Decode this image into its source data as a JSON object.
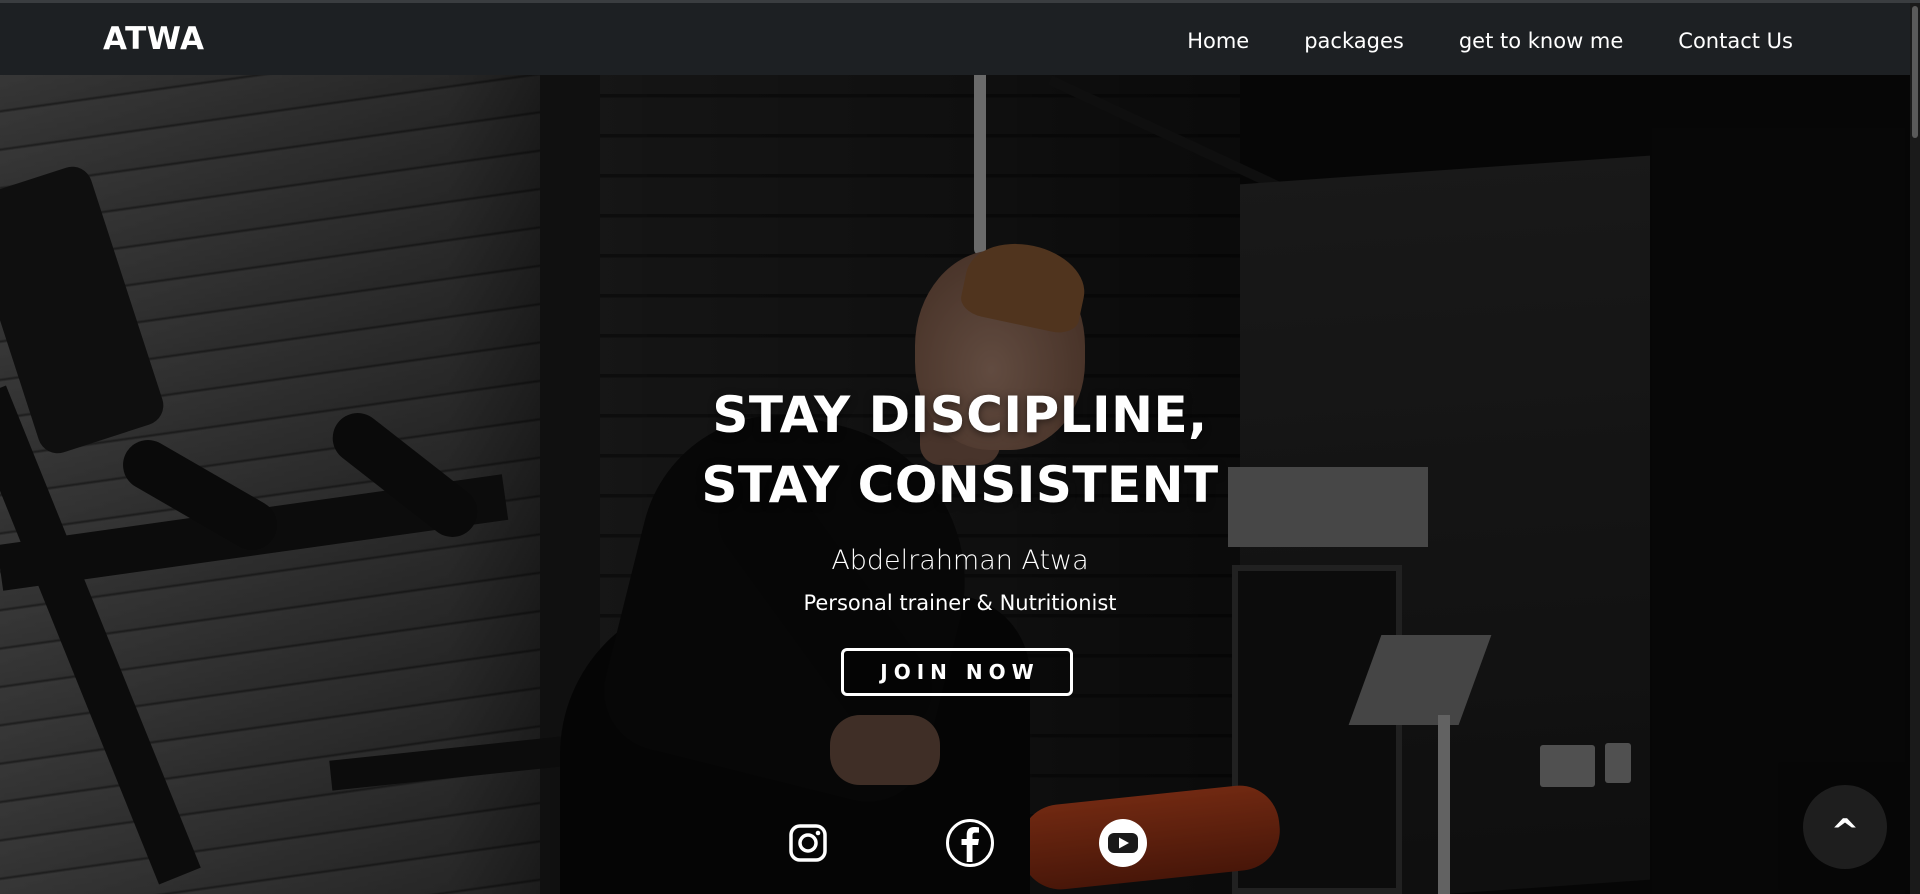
{
  "nav": {
    "brand": "ATWA",
    "links": [
      {
        "label": "Home"
      },
      {
        "label": "packages"
      },
      {
        "label": "get to know me"
      },
      {
        "label": "Contact Us"
      }
    ]
  },
  "hero": {
    "headline_line1": "STAY DISCIPLINE,",
    "headline_line2": "STAY CONSISTENT",
    "name": "Abdelrahman Atwa",
    "role": "Personal trainer & Nutritionist",
    "cta_label": "JOIN NOW"
  },
  "social": [
    {
      "icon": "instagram-icon"
    },
    {
      "icon": "facebook-icon"
    },
    {
      "icon": "youtube-icon"
    }
  ],
  "scroll_top": {
    "label": "^"
  },
  "colors": {
    "navbar_bg": "#1d2023",
    "text": "#ffffff",
    "scroll_top_bg": "#1e1e1e"
  }
}
